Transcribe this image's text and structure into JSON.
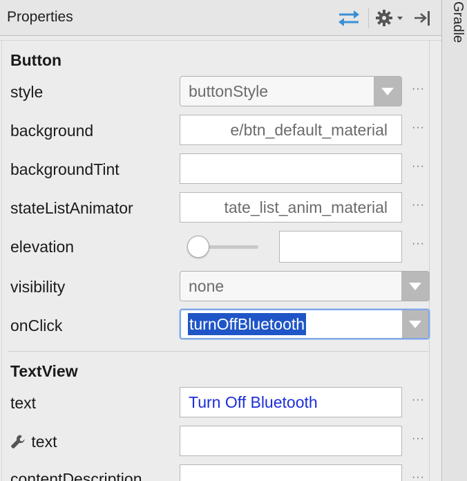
{
  "header": {
    "title": "Properties",
    "icons": [
      "swap-icon",
      "gear-icon",
      "hide-panel-icon"
    ]
  },
  "side_tab": {
    "label": "Gradle"
  },
  "sections": {
    "button": "Button",
    "textview": "TextView"
  },
  "button_props": {
    "style": {
      "label": "style",
      "value": "buttonStyle"
    },
    "background": {
      "label": "background",
      "value": "e/btn_default_material"
    },
    "backgroundTint": {
      "label": "backgroundTint",
      "value": ""
    },
    "stateListAnimator": {
      "label": "stateListAnimator",
      "value": "tate_list_anim_material"
    },
    "elevation": {
      "label": "elevation",
      "value": "",
      "slider_position": 0
    },
    "visibility": {
      "label": "visibility",
      "value": "none"
    },
    "onClick": {
      "label": "onClick",
      "value": "turnOffBluetooth"
    }
  },
  "textview_props": {
    "text": {
      "label": "text",
      "value": "Turn Off Bluetooth"
    },
    "tools_text": {
      "label": "text",
      "value": ""
    },
    "contentDescription": {
      "label": "contentDescription",
      "value": ""
    }
  },
  "more_button_label": "···",
  "colors": {
    "selection": "#1f55c7",
    "link_text": "#1b2ed8",
    "swap_icon": "#3a8fd6"
  }
}
